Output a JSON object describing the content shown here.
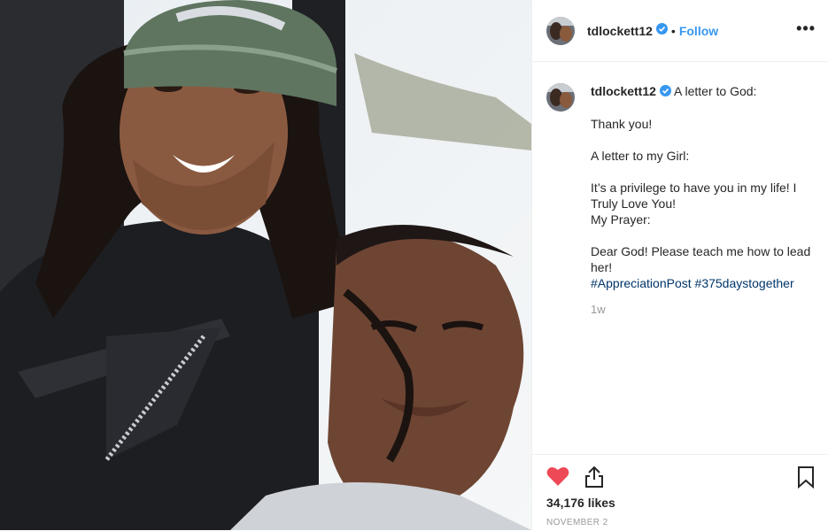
{
  "post": {
    "username": "tdlockett12",
    "separator": "•",
    "follow_label": "Follow",
    "more_label": "•••",
    "caption": {
      "username": "tdlockett12",
      "first_line": "A letter to God:",
      "lines": [
        "Thank you!",
        "",
        "A letter to my Girl:",
        "",
        "It’s a privilege to have you in my life! I Truly Love You!",
        "My Prayer:",
        "",
        "Dear God! Please teach me how to lead her!"
      ],
      "hashtags": [
        "#AppreciationPost",
        "#375daystogether"
      ],
      "time": "1w"
    },
    "likes": "34,176 likes",
    "date": "NOVEMBER 2"
  },
  "icons": {
    "verified": "verified-badge-icon",
    "like": "heart-icon",
    "share": "share-icon",
    "save": "bookmark-icon"
  },
  "colors": {
    "link": "#3897f0",
    "like": "#ed4956",
    "hashtag": "#003569",
    "muted": "#999999"
  }
}
